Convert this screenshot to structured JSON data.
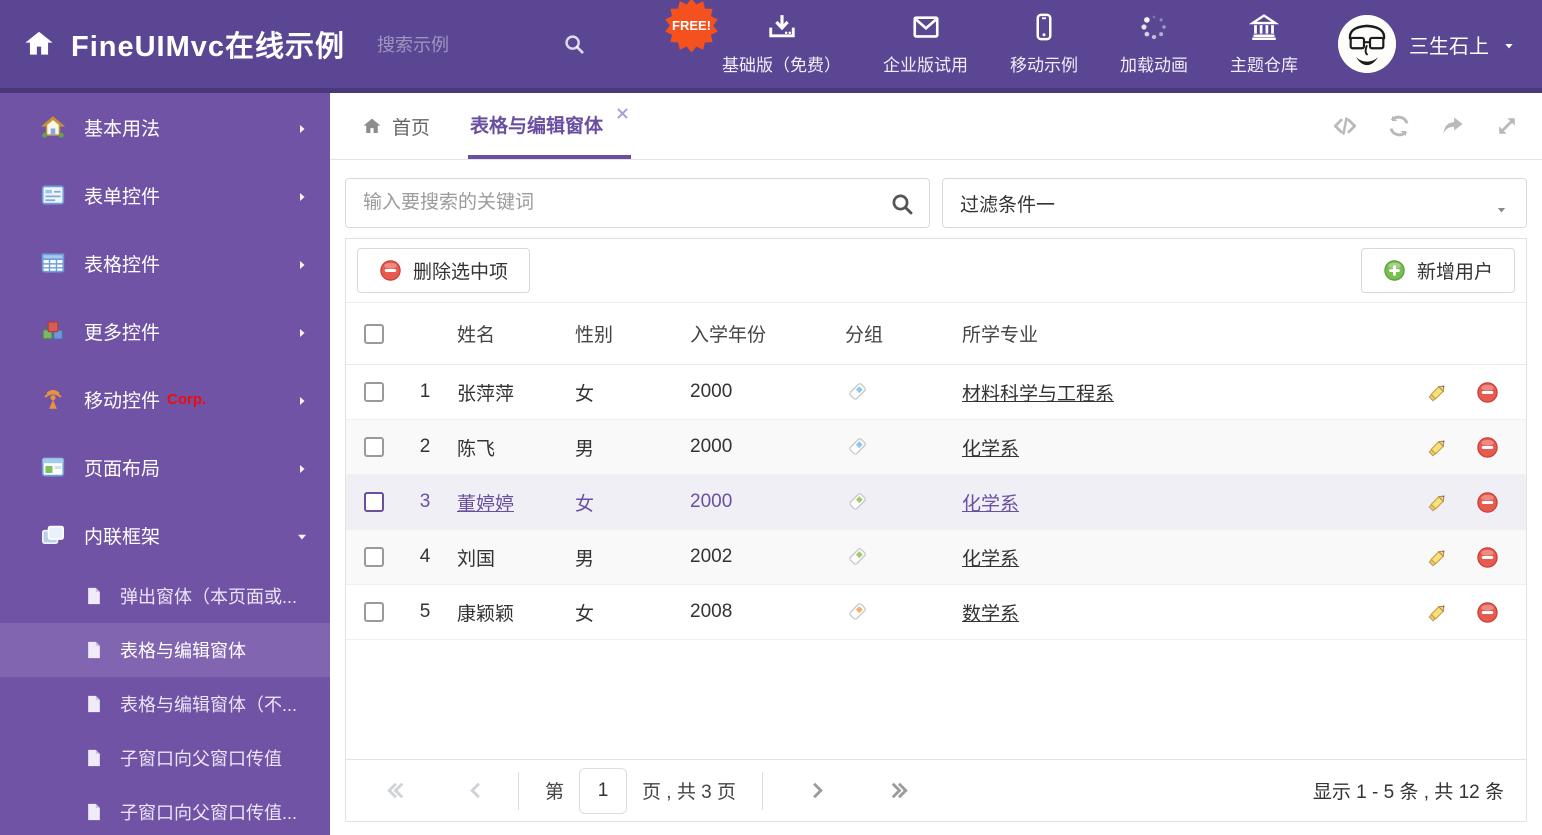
{
  "header": {
    "title": "FineUIMvc在线示例",
    "search_placeholder": "搜索示例",
    "free_badge": "FREE!",
    "nav_items": [
      {
        "label": "基础版（免费）",
        "icon": "download-icon",
        "badge": true
      },
      {
        "label": "企业版试用",
        "icon": "envelope-icon"
      },
      {
        "label": "移动示例",
        "icon": "mobile-icon"
      },
      {
        "label": "加载动画",
        "icon": "spinner-icon"
      },
      {
        "label": "主题仓库",
        "icon": "bank-icon"
      }
    ],
    "user_name": "三生石上"
  },
  "sidebar": {
    "items": [
      {
        "label": "基本用法",
        "icon": "home-color-icon"
      },
      {
        "label": "表单控件",
        "icon": "form-icon"
      },
      {
        "label": "表格控件",
        "icon": "grid-icon"
      },
      {
        "label": "更多控件",
        "icon": "cubes-icon"
      },
      {
        "label": "移动控件",
        "icon": "signal-icon",
        "tag": "Corp."
      },
      {
        "label": "页面布局",
        "icon": "layout-icon"
      },
      {
        "label": "内联框架",
        "icon": "frames-icon",
        "expanded": true,
        "children": [
          {
            "label": "弹出窗体（本页面或..."
          },
          {
            "label": "表格与编辑窗体",
            "selected": true
          },
          {
            "label": "表格与编辑窗体（不..."
          },
          {
            "label": "子窗口向父窗口传值"
          },
          {
            "label": "子窗口向父窗口传值..."
          }
        ]
      }
    ]
  },
  "tabbar": {
    "tabs": [
      {
        "label": "首页",
        "icon": "home-gray-icon"
      },
      {
        "label": "表格与编辑窗体",
        "active": true,
        "closable": true
      }
    ],
    "actions": [
      "code-icon",
      "refresh-icon",
      "share-icon",
      "expand-icon"
    ]
  },
  "filters": {
    "keyword_placeholder": "输入要搜索的关键词",
    "filter_value": "过滤条件一"
  },
  "toolbar": {
    "delete_button": "删除选中项",
    "add_button": "新增用户"
  },
  "table": {
    "headers": {
      "name": "姓名",
      "gender": "性别",
      "year": "入学年份",
      "group": "分组",
      "major": "所学专业"
    },
    "rows": [
      {
        "index": "1",
        "name": "张萍萍",
        "gender": "女",
        "year": "2000",
        "tag_color": "#8CC7F0",
        "major": "材料科学与工程系",
        "selected": false,
        "zebra": false
      },
      {
        "index": "2",
        "name": "陈飞",
        "gender": "男",
        "year": "2000",
        "tag_color": "#8CC7F0",
        "major": "化学系",
        "selected": false,
        "zebra": true
      },
      {
        "index": "3",
        "name": "董婷婷",
        "gender": "女",
        "year": "2000",
        "tag_color": "#9BCE67",
        "major": "化学系",
        "selected": true,
        "zebra": false
      },
      {
        "index": "4",
        "name": "刘国",
        "gender": "男",
        "year": "2002",
        "tag_color": "#9BCE67",
        "major": "化学系",
        "selected": false,
        "zebra": true
      },
      {
        "index": "5",
        "name": "康颖颖",
        "gender": "女",
        "year": "2008",
        "tag_color": "#F6AE6F",
        "major": "数学系",
        "selected": false,
        "zebra": false
      }
    ]
  },
  "pagination": {
    "prefix": "第",
    "page_value": "1",
    "suffix": "页 , 共 3 页",
    "summary": "显示 1 - 5 条 , 共 12 条"
  },
  "colors": {
    "header_bg": "#5A4692",
    "sidebar_bg": "#7153A6",
    "sidebar_selected_bg": "#8265B1",
    "accent_purple": "#6A4FA1",
    "free_badge_bg": "#F4511E",
    "selected_row_bg": "#F1EFF6"
  }
}
